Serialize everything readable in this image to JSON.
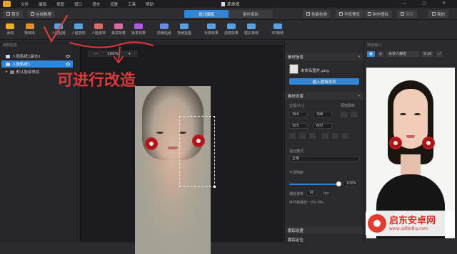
{
  "menubar": {
    "items": [
      "文件",
      "编辑",
      "视图",
      "窗口",
      "语言",
      "设置",
      "工具",
      "帮助"
    ],
    "title": "未命名",
    "window_controls": "— ▢ ✕"
  },
  "topbar": {
    "home": "首页",
    "tutorial": "在线教程",
    "tabs": [
      "设计面板",
      "事件面板"
    ],
    "right_buttons": [
      "性能检测",
      "手机预览",
      "制作图标",
      "保存"
    ],
    "right_last": "我的"
  },
  "tools": [
    {
      "label": "添加",
      "color": "#e8b020"
    },
    {
      "label": "特效库",
      "color": "#e0902a"
    },
    {
      "label": "人脸贴纸",
      "color": "#5aa0e0"
    },
    {
      "label": "人脸变形",
      "color": "#5aa0e0"
    },
    {
      "label": "人脸遮罩",
      "color": "#d86a6a"
    },
    {
      "label": "美妆效果",
      "color": "#d86aa0"
    },
    {
      "label": "染发效果",
      "color": "#b05ae0"
    },
    {
      "label": "前景贴纸",
      "color": "#6a8ae0"
    },
    {
      "label": "背景抠图",
      "color": "#5aa0e0"
    },
    {
      "label": "分屏效果",
      "color": "#5aa0e0"
    },
    {
      "label": "滤镜效果",
      "color": "#5aa0e0"
    },
    {
      "label": "镜头特效",
      "color": "#5aa0e0"
    },
    {
      "label": "3D特效",
      "color": "#5aa0e0"
    }
  ],
  "layers_panel": {
    "title": "特效信息",
    "layers": [
      "人脸贴纸1副本1",
      "人脸贴纸1",
      "默认脸部美妆"
    ]
  },
  "canvas": {
    "zoom_minus": "—",
    "zoom": "100%",
    "zoom_plus": "+",
    "annotation": "可进行改造"
  },
  "properties": {
    "section_material": "素材信息",
    "material_name": "未命名图片.png",
    "insert_button": "插入遮挡序列",
    "section_settings": "素材设置",
    "pos_size_label": "位置/大小",
    "mirror_label": "图像翻转",
    "pos_values": [
      "394",
      "396",
      "305",
      "607"
    ],
    "blend_label": "混合模式",
    "blend_value": "正常",
    "opacity_label": "不透明度",
    "opacity_value": "100%",
    "opacity_level": 1.0,
    "fps_label": "播放速率",
    "fps_value": "16",
    "fps_unit": "fps",
    "duration_text": "序列帧播放一次0.06s",
    "section_display": "跟踪设置",
    "section_tracking": "跟踪定位"
  },
  "preview": {
    "title": "预览窗口",
    "model": "女单人静态",
    "ratio": "9:16"
  },
  "watermark": {
    "brand": "启东安卓网",
    "url": "www.qdtbdhy.com"
  }
}
